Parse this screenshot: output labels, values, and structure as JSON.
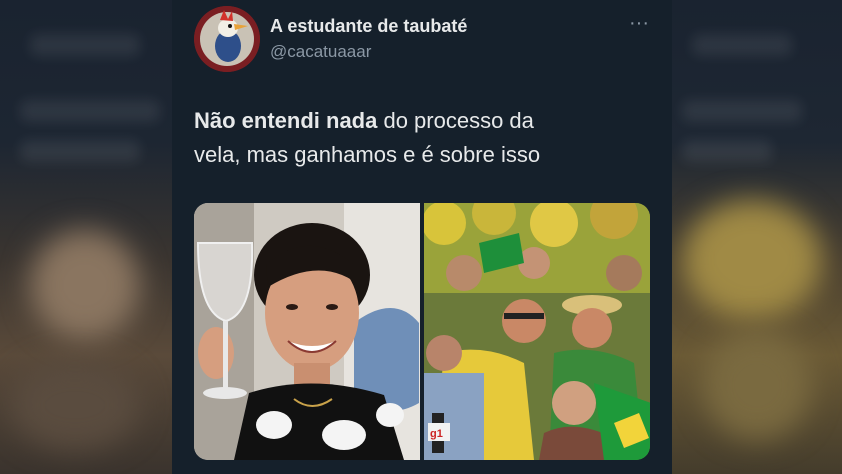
{
  "tweet": {
    "display_name": "A estudante de taubaté",
    "handle": "@cacatuaaar",
    "more_label": "···",
    "text_bold": "Não entendi nada",
    "text_line1_rest": " do processo da",
    "text_line2": "vela, mas ganhamos e é sobre isso"
  },
  "media": {
    "photo_left_label": "selfie-with-wine-glass",
    "photo_right_label": "crowd-celebration",
    "tv_logo": "g1"
  },
  "colors": {
    "card_bg": "#15202b",
    "text_primary": "#e7e9ea",
    "text_secondary": "#8b98a5"
  }
}
